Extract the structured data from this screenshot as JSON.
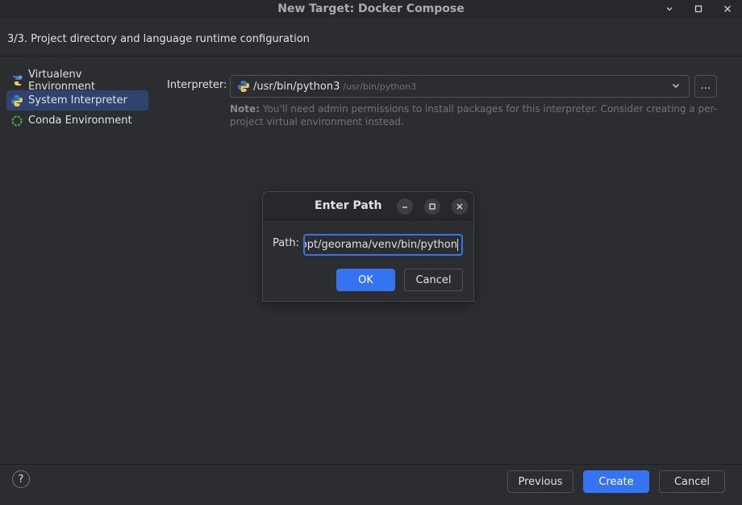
{
  "window": {
    "title": "New Target: Docker Compose",
    "controls": [
      "chevron-down-icon",
      "maximize-icon",
      "close-icon"
    ]
  },
  "step": {
    "text": "3/3. Project directory and language runtime configuration"
  },
  "sidebar": {
    "items": [
      {
        "label": "Virtualenv Environment",
        "icon": "virtualenv-icon",
        "selected": false
      },
      {
        "label": "System Interpreter",
        "icon": "python-icon",
        "selected": true
      },
      {
        "label": "Conda Environment",
        "icon": "conda-icon",
        "selected": false
      }
    ]
  },
  "interpreter": {
    "label": "Interpreter:",
    "value": "/usr/bin/python3",
    "value_sub": "/usr/bin/python3",
    "browse_label": "...",
    "note_bold": "Note:",
    "note_text": " You'll need admin permissions to install packages for this interpreter. Consider creating a per-project virtual environment instead."
  },
  "dialog": {
    "title": "Enter Path",
    "path_label": "Path:",
    "path_value": "/opt/georama/venv/bin/python",
    "ok_label": "OK",
    "cancel_label": "Cancel"
  },
  "footer": {
    "help_label": "?",
    "previous_label": "Previous",
    "create_label": "Create",
    "cancel_label": "Cancel"
  },
  "colors": {
    "accent": "#3574f0",
    "background": "#2b2d30",
    "selected": "#2e436e"
  }
}
